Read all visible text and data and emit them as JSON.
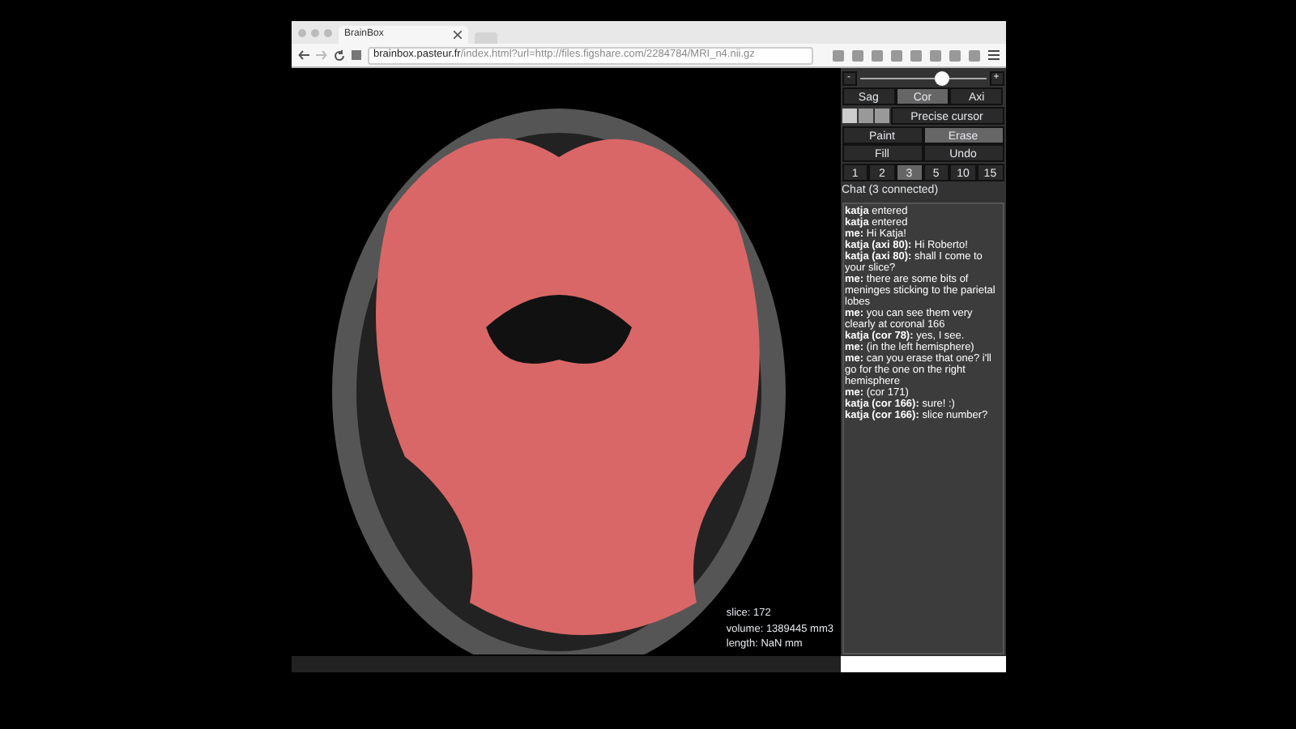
{
  "browser": {
    "tab_title": "BrainBox",
    "url_host": "brainbox.pasteur.fr",
    "url_path": "/index.html?url=http://files.figshare.com/2284784/MRI_n4.nii.gz"
  },
  "viewer": {
    "info": [
      "slice: 172",
      "volume: 1389445 mm3",
      "length: NaN mm"
    ]
  },
  "panel": {
    "zoom": {
      "minus": "-",
      "plus": "+",
      "level": 0.65
    },
    "planes": [
      {
        "label": "Sag",
        "selected": false
      },
      {
        "label": "Cor",
        "selected": true
      },
      {
        "label": "Axi",
        "selected": false
      }
    ],
    "precise_cursor": "Precise cursor",
    "tools": [
      {
        "label": "Paint",
        "selected": false
      },
      {
        "label": "Erase",
        "selected": true
      },
      {
        "label": "Fill",
        "selected": false
      },
      {
        "label": "Undo",
        "selected": false
      }
    ],
    "brush_sizes": [
      {
        "label": "1",
        "selected": false
      },
      {
        "label": "2",
        "selected": false
      },
      {
        "label": "3",
        "selected": true
      },
      {
        "label": "5",
        "selected": false
      },
      {
        "label": "10",
        "selected": false
      },
      {
        "label": "15",
        "selected": false
      }
    ],
    "chat_title": "Chat (3 connected)",
    "messages": [
      {
        "who": "katja",
        "text": "entered"
      },
      {
        "who": "katja",
        "text": "entered"
      },
      {
        "who": "me:",
        "text": "Hi Katja!"
      },
      {
        "who": "katja (axi 80):",
        "text": "Hi Roberto!"
      },
      {
        "who": "katja (axi 80):",
        "text": "shall I come to your slice?"
      },
      {
        "who": "me:",
        "text": "there are some bits of meninges sticking to the parietal lobes"
      },
      {
        "who": "me:",
        "text": "you can see them very clearly at coronal 166"
      },
      {
        "who": "katja (cor 78):",
        "text": "yes, I see."
      },
      {
        "who": "me:",
        "text": "(in the left hemisphere)"
      },
      {
        "who": "me:",
        "text": "can you erase that one? i'll go for the one on the right hemisphere"
      },
      {
        "who": "me:",
        "text": "(cor 171)"
      },
      {
        "who": "katja (cor 166):",
        "text": "sure! :)"
      },
      {
        "who": "katja (cor 166):",
        "text": "slice number?"
      }
    ]
  }
}
